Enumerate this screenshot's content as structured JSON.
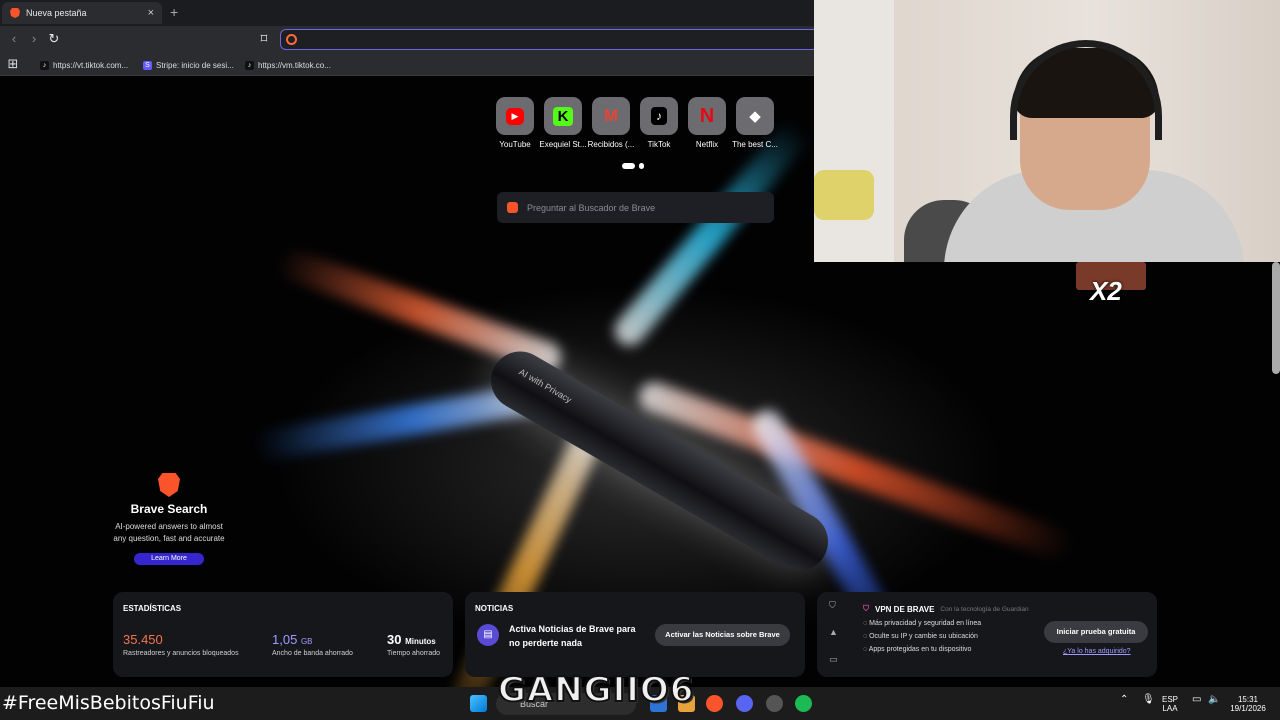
{
  "browser": {
    "tab_title": "Nueva pestaña",
    "tab_close": "×",
    "new_tab": "+",
    "nav": {
      "back": "‹",
      "forward": "›",
      "reload": "↻",
      "bookmark": "⌑",
      "apps": "⊞"
    },
    "url_value": "",
    "bookmarks": [
      {
        "label": "https://vt.tiktok.com...",
        "icon": "tiktok-icon"
      },
      {
        "label": "Stripe: inicio de sesi...",
        "icon": "stripe-icon"
      },
      {
        "label": "https://vm.tiktok.co...",
        "icon": "tiktok-icon"
      }
    ]
  },
  "newtab": {
    "shortcuts": [
      {
        "label": "YouTube",
        "glyph": "▶",
        "color": "#ff0000"
      },
      {
        "label": "Exequiel St...",
        "glyph": "K",
        "color": "#53fc18"
      },
      {
        "label": "Recibidos (...",
        "glyph": "M",
        "color": "#ea4335"
      },
      {
        "label": "TikTok",
        "glyph": "♪",
        "color": "#000000"
      },
      {
        "label": "Netflix",
        "glyph": "N",
        "color": "#e50914"
      },
      {
        "label": "The best C...",
        "glyph": "◆",
        "color": "#ffffff"
      }
    ],
    "search_placeholder": "Preguntar al Buscador de Brave",
    "hero_text": "AI with Privacy",
    "brave_search": {
      "title": "Brave Search",
      "description": "AI-powered answers to almost any question, fast and accurate",
      "button": "Learn More"
    },
    "stats": {
      "heading": "ESTADÍSTICAS",
      "trackers_value": "35.450",
      "trackers_label": "Rastreadores y anuncios bloqueados",
      "bandwidth_value": "1,05",
      "bandwidth_unit": "GB",
      "bandwidth_label": "Ancho de banda ahorrado",
      "time_value": "30",
      "time_unit": "Minutos",
      "time_label": "Tiempo ahorrado"
    },
    "news": {
      "heading": "NOTICIAS",
      "text": "Activa Noticias de Brave para no perderte nada",
      "button": "Activar las Noticias sobre Brave"
    },
    "vpn": {
      "heading": "VPN DE BRAVE",
      "powered": "Con la tecnología de  Guardian",
      "features": [
        "Más privacidad y seguridad en línea",
        "Oculte su IP y cambie su ubicación",
        "Apps protegidas en tu dispositivo"
      ],
      "button": "Iniciar prueba gratuita",
      "link": "¿Ya lo has adquirido?"
    }
  },
  "overlay": {
    "multiplier": "X2",
    "watermark": "GANGIIO6",
    "hashtag": "#FreeMisBebitosFiuFiu"
  },
  "taskbar": {
    "search_label": "Buscar",
    "lang_top": "ESP",
    "lang_bottom": "LAA",
    "time": "15:31",
    "date": "19/1/2026"
  },
  "colors": {
    "accent": "#6f63e8",
    "brave_orange": "#fb542b",
    "stat_orange": "#f4744f",
    "stat_purple": "#a29bff"
  }
}
